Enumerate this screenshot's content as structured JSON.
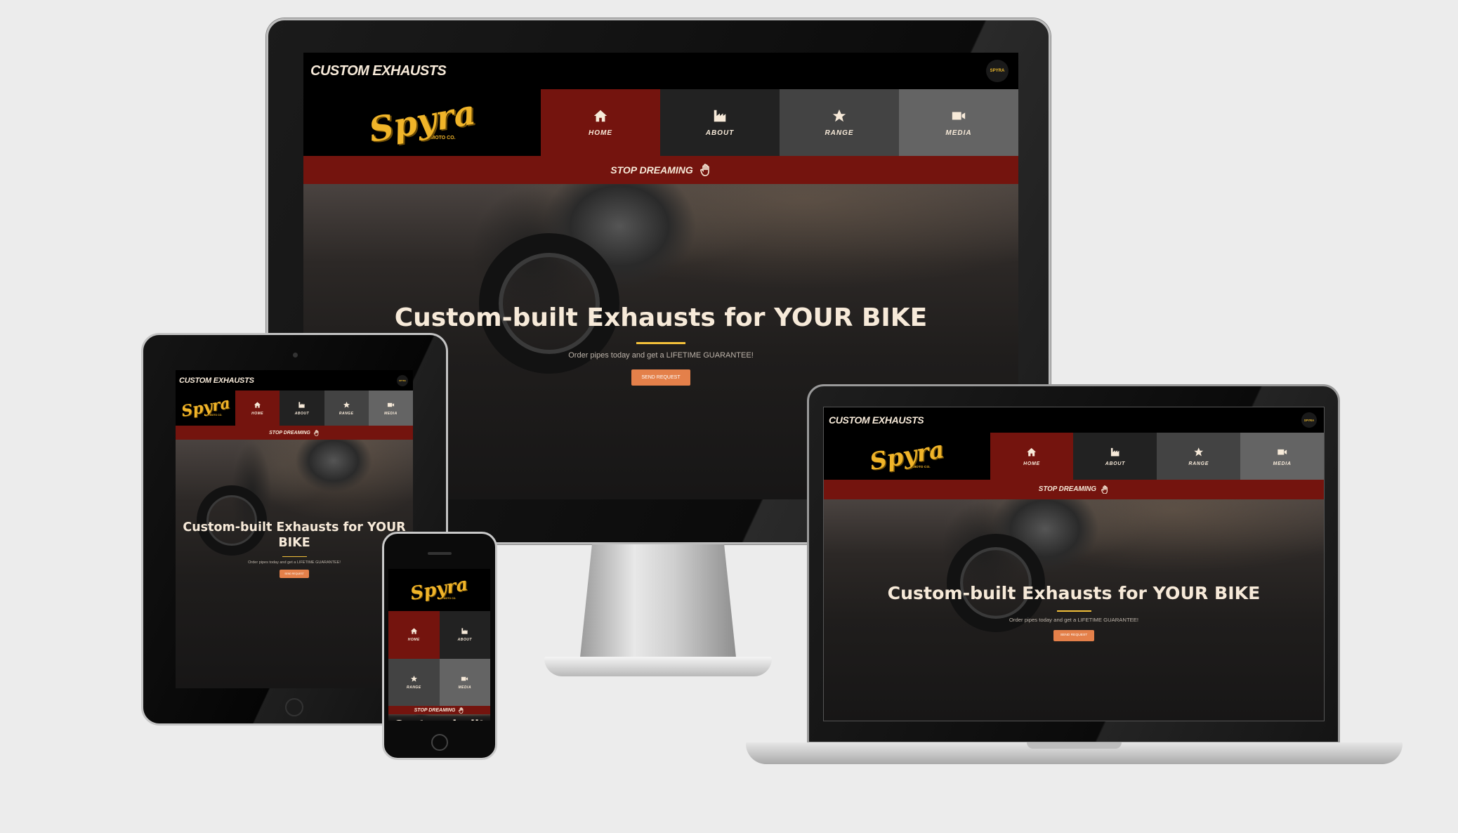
{
  "site": {
    "header_title": "CUSTOM EXHAUSTS",
    "badge": "SPYRA",
    "logo": "Spyra",
    "logo_sub": "MOTO CO.",
    "nav": [
      {
        "label": "HOME",
        "icon": "home-icon",
        "active": true
      },
      {
        "label": "ABOUT",
        "icon": "factory-icon"
      },
      {
        "label": "RANGE",
        "icon": "star-icon"
      },
      {
        "label": "MEDIA",
        "icon": "video-camera-icon"
      }
    ],
    "stop_label": "STOP DREAMING",
    "stop_icon": "hand-icon",
    "hero": {
      "headline": "Custom-built Exhausts for YOUR BIKE",
      "subtext": "Order pipes today and get a LIFETIME GUARANTEE!",
      "button": "SEND REQUEST"
    }
  },
  "colors": {
    "primary_red": "#74140e",
    "accent_yellow": "#f2bf3a",
    "button_orange": "#e4804a",
    "logo_yellow": "#f0b429"
  }
}
